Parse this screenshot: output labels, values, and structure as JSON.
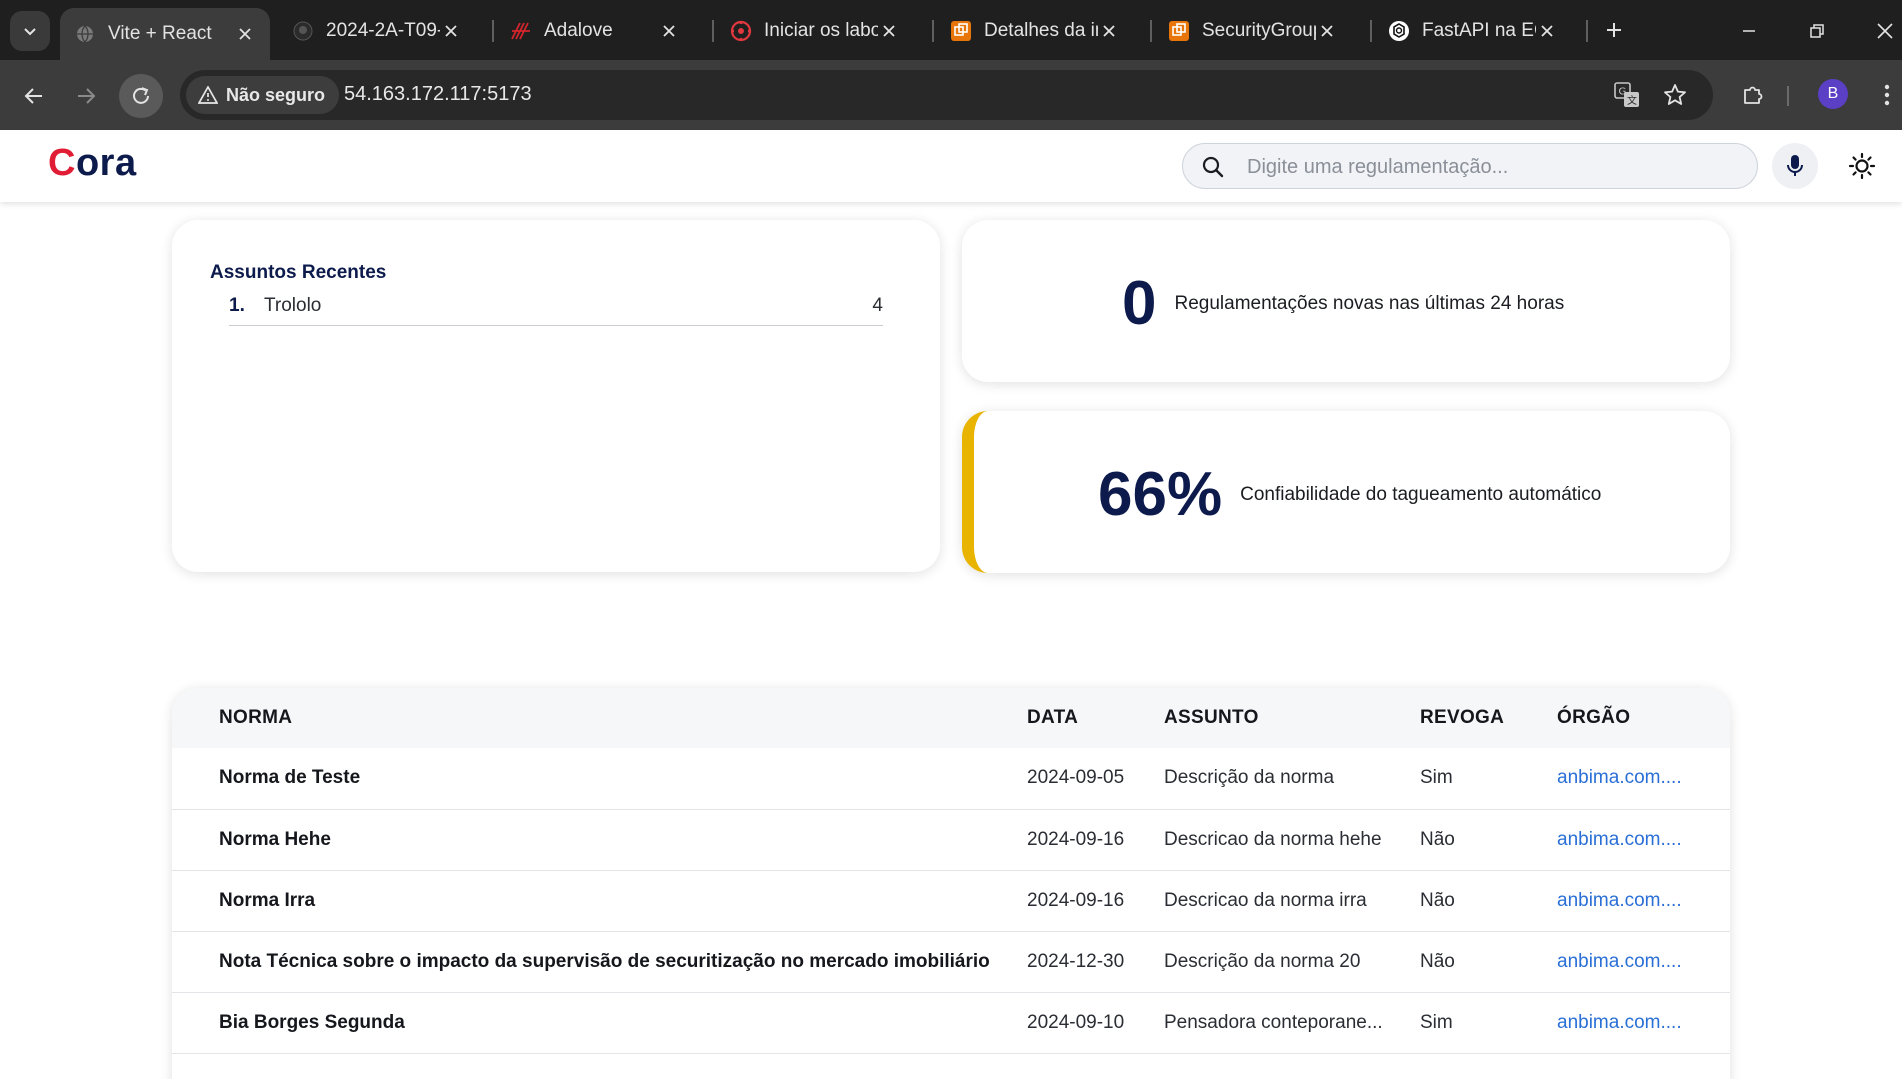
{
  "browser": {
    "tabs": [
      {
        "title": "Vite + React",
        "icon": "globe-icon",
        "active": true
      },
      {
        "title": "2024-2A-T09-",
        "icon": "github-icon",
        "active": false
      },
      {
        "title": "Adalove",
        "icon": "adalove-icon",
        "active": false
      },
      {
        "title": "Iniciar os labo",
        "icon": "canvas-icon",
        "active": false
      },
      {
        "title": "Detalhes da in",
        "icon": "aws-icon",
        "active": false
      },
      {
        "title": "SecurityGroup",
        "icon": "aws-icon",
        "active": false
      },
      {
        "title": "FastAPI na EC",
        "icon": "openai-icon",
        "active": false
      }
    ],
    "security_label": "Não seguro",
    "url": "54.163.172.117:5173",
    "profile_initial": "B"
  },
  "app": {
    "logo_first": "C",
    "logo_rest": "ora",
    "search_placeholder": "Digite uma regulamentação..."
  },
  "recent": {
    "title": "Assuntos Recentes",
    "items": [
      {
        "rank": "1.",
        "name": "Trololo",
        "count": "4"
      }
    ]
  },
  "stats": [
    {
      "value": "0",
      "label": "Regulamentações novas nas últimas 24 horas"
    },
    {
      "value": "66%",
      "label": "Confiabilidade do tagueamento automático",
      "accent": "#e9b400"
    }
  ],
  "table": {
    "headers": [
      "NORMA",
      "DATA",
      "ASSUNTO",
      "REVOGA",
      "ÓRGÃO"
    ],
    "rows": [
      {
        "norma": "Norma de Teste",
        "data": "2024-09-05",
        "assunto": "Descrição da norma",
        "revoga": "Sim",
        "orgao": "anbima.com...."
      },
      {
        "norma": "Norma Hehe",
        "data": "2024-09-16",
        "assunto": "Descricao da norma hehe",
        "revoga": "Não",
        "orgao": "anbima.com...."
      },
      {
        "norma": "Norma Irra",
        "data": "2024-09-16",
        "assunto": "Descricao da norma irra",
        "revoga": "Não",
        "orgao": "anbima.com...."
      },
      {
        "norma": "Nota Técnica sobre o impacto da supervisão de securitização no mercado imobiliário",
        "data": "2024-12-30",
        "assunto": "Descrição da norma 20",
        "revoga": "Não",
        "orgao": "anbima.com...."
      },
      {
        "norma": "Bia Borges Segunda",
        "data": "2024-09-10",
        "assunto": "Pensadora conteporane...",
        "revoga": "Sim",
        "orgao": "anbima.com...."
      }
    ]
  },
  "colors": {
    "brand_navy": "#0d1b4c",
    "brand_red": "#e11d35",
    "link": "#2a6fd6",
    "accent_yellow": "#e9b400"
  }
}
